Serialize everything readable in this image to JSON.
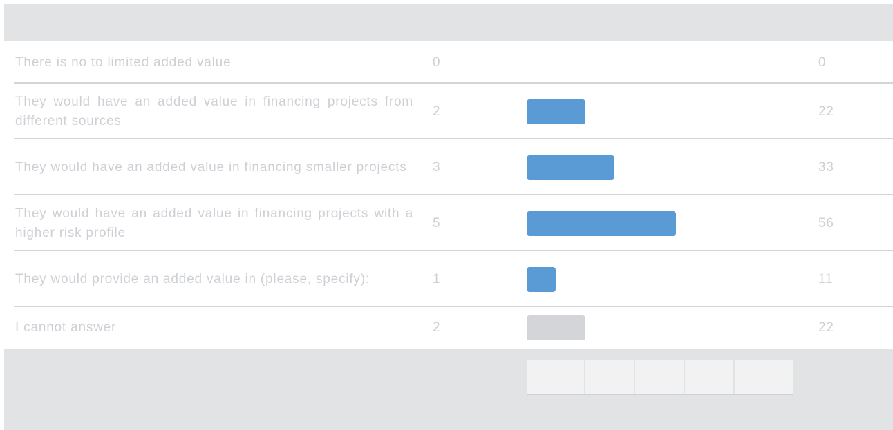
{
  "chart_data": {
    "type": "bar",
    "orientation": "horizontal",
    "categories": [
      "There is no to limited added value",
      "They would have an added value in financing projects from different sources",
      "They would have an added value in financing smaller projects",
      "They would have an added value in financing projects with a higher risk profile",
      "They would provide an added value in (please, specify):",
      "I cannot answer"
    ],
    "values": [
      0,
      22,
      33,
      56,
      11,
      22
    ],
    "counts": [
      "0",
      "2",
      "3",
      "5",
      "1",
      "2"
    ],
    "percent_labels": [
      "0",
      "22",
      "33",
      "56",
      "11",
      "22"
    ],
    "xlim": [
      0,
      100
    ],
    "colors": {
      "answer": "#5b9bd5",
      "cannot_answer": "#d4d5d8"
    },
    "neutral_rows": [
      5
    ],
    "axis_cells": 5
  }
}
